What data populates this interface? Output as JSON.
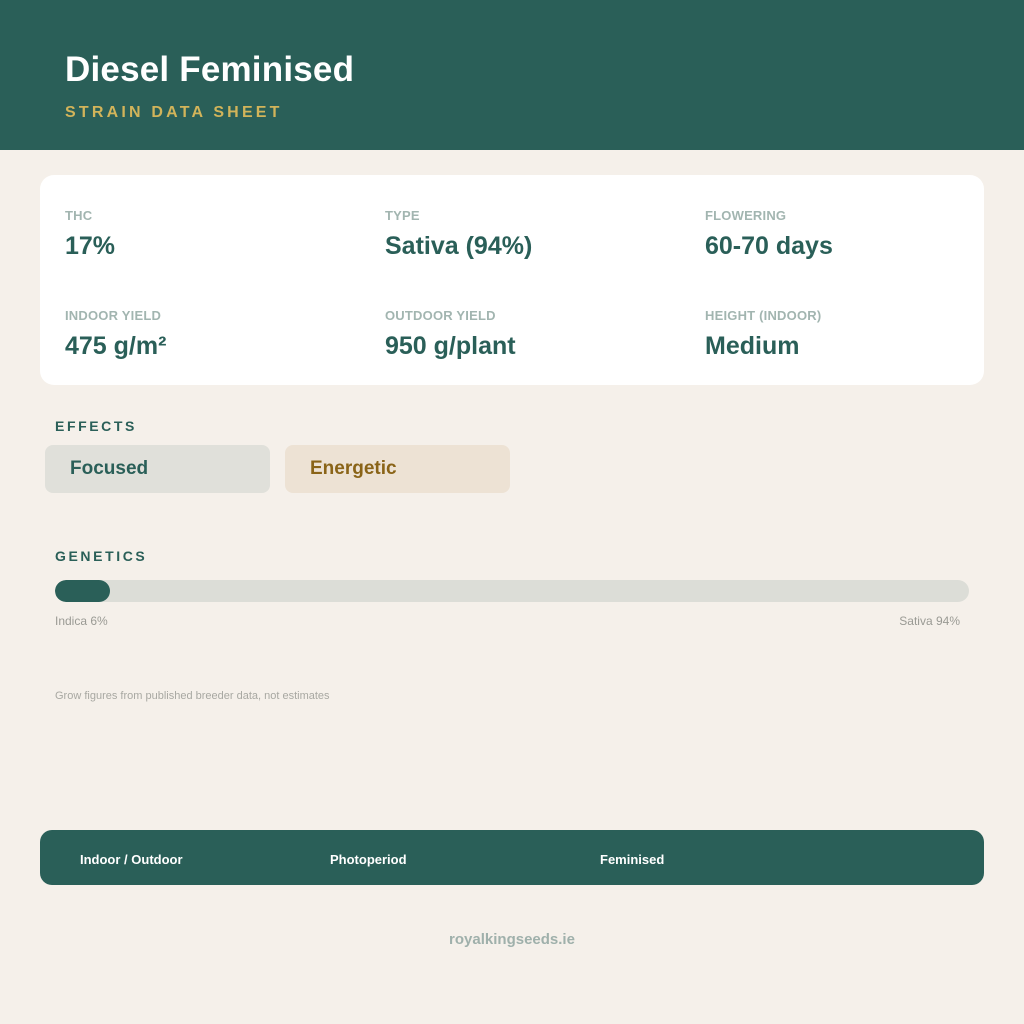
{
  "header": {
    "title": "Diesel Feminised",
    "subtitle": "STRAIN DATA SHEET"
  },
  "stats": [
    {
      "label": "THC",
      "value": "17%"
    },
    {
      "label": "TYPE",
      "value": "Sativa (94%)"
    },
    {
      "label": "FLOWERING",
      "value": "60-70 days"
    },
    {
      "label": "INDOOR YIELD",
      "value": "475 g/m²"
    },
    {
      "label": "OUTDOOR YIELD",
      "value": "950 g/plant"
    },
    {
      "label": "HEIGHT (INDOOR)",
      "value": "Medium"
    }
  ],
  "effects": {
    "label": "EFFECTS",
    "items": [
      "Focused",
      "Energetic"
    ]
  },
  "genetics": {
    "label": "GENETICS",
    "indica_percent": 6,
    "sativa_percent": 94,
    "indica_caption": "Indica 6%",
    "sativa_caption": "Sativa 94%"
  },
  "note": "Grow figures from published breeder data, not estimates",
  "footer": {
    "items": [
      "Indoor / Outdoor",
      "Photoperiod",
      "Feminised"
    ]
  },
  "site": "royalkingseeds.ie",
  "colors": {
    "primary": "#2a5f58",
    "accent_gold": "#d2b45a",
    "background": "#f5f0ea"
  }
}
